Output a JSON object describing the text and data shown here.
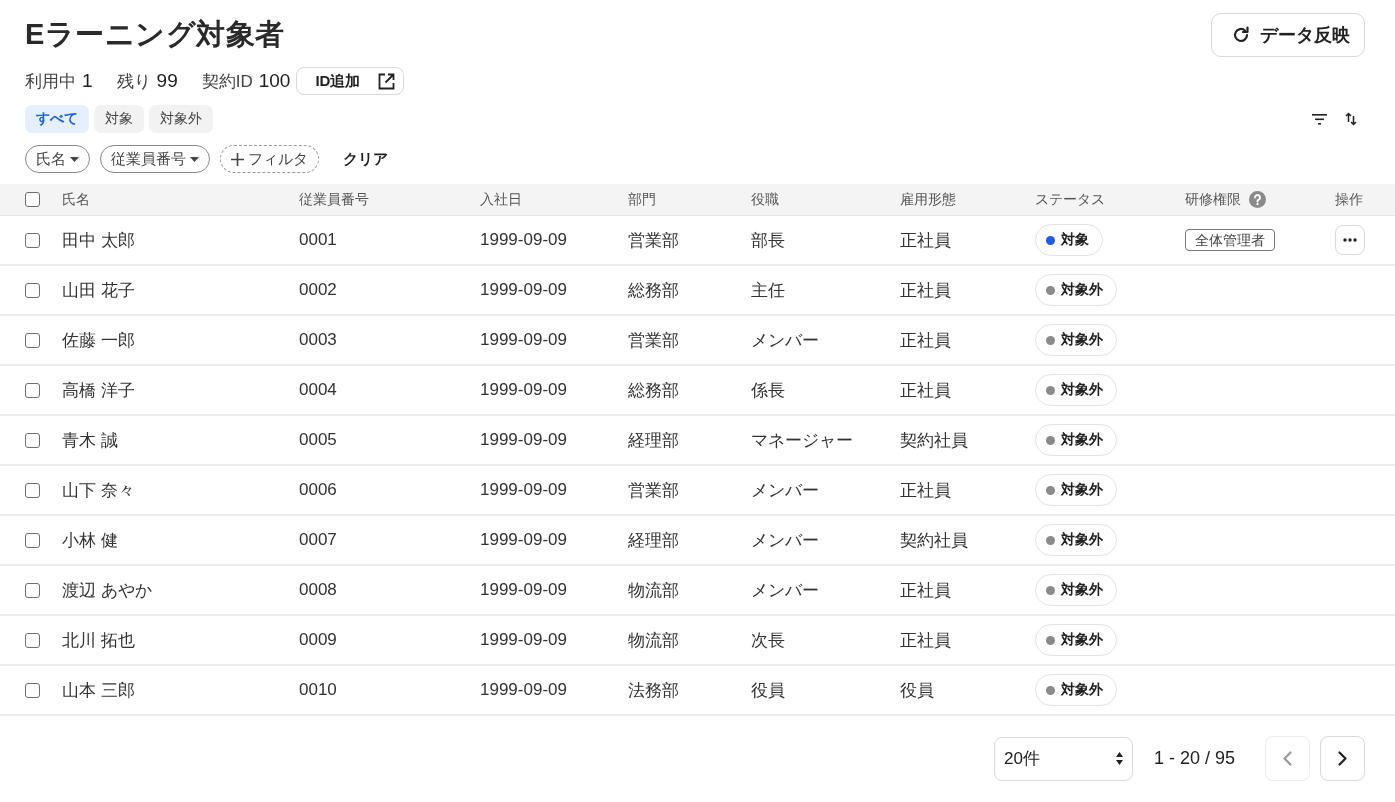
{
  "page": {
    "title": "Eラーニング対象者",
    "refresh_button": "データ反映"
  },
  "stats": [
    {
      "label": "利用中",
      "value": "1"
    },
    {
      "label": "残り",
      "value": "99"
    },
    {
      "label": "契約ID",
      "value": "100"
    }
  ],
  "add_id_button": "ID追加",
  "tabs": [
    {
      "label": "すべて",
      "selected": true
    },
    {
      "label": "対象",
      "selected": false
    },
    {
      "label": "対象外",
      "selected": false
    }
  ],
  "filters": [
    {
      "label": "氏名",
      "kind": "dropdown"
    },
    {
      "label": "従業員番号",
      "kind": "dropdown"
    },
    {
      "label": "フィルタ",
      "kind": "add"
    }
  ],
  "clear_button": "クリア",
  "table": {
    "select_all": {
      "checked": false
    },
    "columns": [
      {
        "label": "氏名",
        "help": false
      },
      {
        "label": "従業員番号",
        "help": false
      },
      {
        "label": "入社日",
        "help": false
      },
      {
        "label": "部門",
        "help": false
      },
      {
        "label": "役職",
        "help": false
      },
      {
        "label": "雇用形態",
        "help": false
      },
      {
        "label": "ステータス",
        "help": false
      },
      {
        "label": "研修権限",
        "help": true
      },
      {
        "label": "操作",
        "help": false
      }
    ],
    "rows": [
      {
        "checked": false,
        "name": "田中 太郎",
        "employee_no": "0001",
        "hire_date": "1999-09-09",
        "department": "営業部",
        "position": "部長",
        "employment": "正社員",
        "status": {
          "label": "対象",
          "color": "#1f5eea"
        },
        "role": "全体管理者",
        "actions_menu": true
      },
      {
        "checked": false,
        "name": "山田 花子",
        "employee_no": "0002",
        "hire_date": "1999-09-09",
        "department": "総務部",
        "position": "主任",
        "employment": "正社員",
        "status": {
          "label": "対象外",
          "color": "#8a8a8a"
        },
        "actions_menu": false
      },
      {
        "checked": false,
        "name": "佐藤 一郎",
        "employee_no": "0003",
        "hire_date": "1999-09-09",
        "department": "営業部",
        "position": "メンバー",
        "employment": "正社員",
        "status": {
          "label": "対象外",
          "color": "#8a8a8a"
        },
        "actions_menu": false
      },
      {
        "checked": false,
        "name": "高橋 洋子",
        "employee_no": "0004",
        "hire_date": "1999-09-09",
        "department": "総務部",
        "position": "係長",
        "employment": "正社員",
        "status": {
          "label": "対象外",
          "color": "#8a8a8a"
        },
        "actions_menu": false
      },
      {
        "checked": false,
        "name": "青木 誠",
        "employee_no": "0005",
        "hire_date": "1999-09-09",
        "department": "経理部",
        "position": "マネージャー",
        "employment": "契約社員",
        "status": {
          "label": "対象外",
          "color": "#8a8a8a"
        },
        "actions_menu": false
      },
      {
        "checked": false,
        "name": "山下 奈々",
        "employee_no": "0006",
        "hire_date": "1999-09-09",
        "department": "営業部",
        "position": "メンバー",
        "employment": "正社員",
        "status": {
          "label": "対象外",
          "color": "#8a8a8a"
        },
        "actions_menu": false
      },
      {
        "checked": false,
        "name": "小林 健",
        "employee_no": "0007",
        "hire_date": "1999-09-09",
        "department": "経理部",
        "position": "メンバー",
        "employment": "契約社員",
        "status": {
          "label": "対象外",
          "color": "#8a8a8a"
        },
        "actions_menu": false
      },
      {
        "checked": false,
        "name": "渡辺 あやか",
        "employee_no": "0008",
        "hire_date": "1999-09-09",
        "department": "物流部",
        "position": "メンバー",
        "employment": "正社員",
        "status": {
          "label": "対象外",
          "color": "#8a8a8a"
        },
        "actions_menu": false
      },
      {
        "checked": false,
        "name": "北川 拓也",
        "employee_no": "0009",
        "hire_date": "1999-09-09",
        "department": "物流部",
        "position": "次長",
        "employment": "正社員",
        "status": {
          "label": "対象外",
          "color": "#8a8a8a"
        },
        "actions_menu": false
      },
      {
        "checked": false,
        "name": "山本 三郎",
        "employee_no": "0010",
        "hire_date": "1999-09-09",
        "department": "法務部",
        "position": "役員",
        "employment": "役員",
        "status": {
          "label": "対象外",
          "color": "#8a8a8a"
        },
        "actions_menu": false
      }
    ]
  },
  "pagination": {
    "page_size": "20件",
    "range": "1 - 20 / 95",
    "prev": {
      "disabled": true
    },
    "next": {
      "disabled": false
    }
  }
}
